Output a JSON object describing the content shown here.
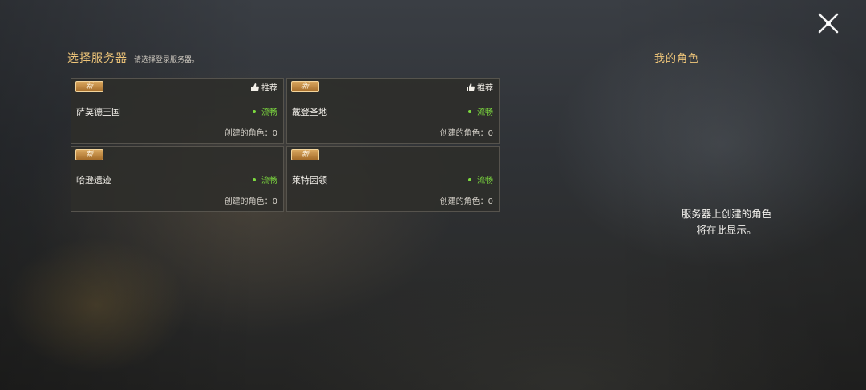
{
  "server_select": {
    "title": "选择服务器",
    "subtitle": "请选择登录服务器。",
    "servers": [
      {
        "badge": "新",
        "recommend": "推荐",
        "name": "萨莫德王国",
        "status": "流畅",
        "characters_label": "创建的角色：0"
      },
      {
        "badge": "新",
        "recommend": "推荐",
        "name": "戴登圣地",
        "status": "流畅",
        "characters_label": "创建的角色：0"
      },
      {
        "badge": "新",
        "name": "哈逊遗迹",
        "status": "流畅",
        "characters_label": "创建的角色：0"
      },
      {
        "badge": "新",
        "name": "莱特因领",
        "status": "流畅",
        "characters_label": "创建的角色：0"
      }
    ]
  },
  "my_characters": {
    "title": "我的角色",
    "empty_line1": "服务器上创建的角色",
    "empty_line2": "将在此显示。"
  },
  "icons": {
    "close": "close-icon",
    "recommend": "thumbs-up-icon",
    "status": "status-dot-icon"
  },
  "colors": {
    "accent_gold": "#f1c77a",
    "status_green": "#7ddb3f",
    "badge_orange": "#c08540",
    "card_bg": "#2e2d2a"
  }
}
